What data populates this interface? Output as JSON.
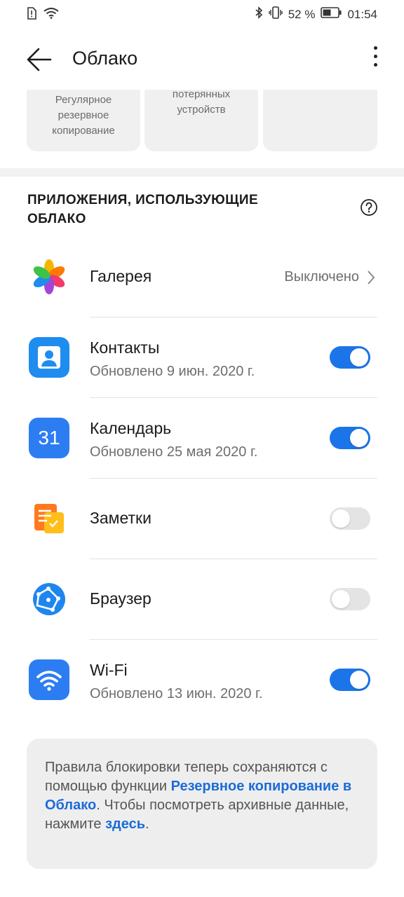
{
  "status_bar": {
    "battery_percent": "52 %",
    "time": "01:54"
  },
  "header": {
    "title": "Облако"
  },
  "feature_cards": [
    {
      "label": "Регулярное резервное копирование"
    },
    {
      "label": "потерянных устройств"
    },
    {
      "label": ""
    }
  ],
  "section": {
    "title": "ПРИЛОЖЕНИЯ, ИСПОЛЬЗУЮЩИЕ ОБЛАКО"
  },
  "apps": [
    {
      "name": "Галерея",
      "value": "Выключено",
      "icon": "gallery-icon"
    },
    {
      "name": "Контакты",
      "subtitle": "Обновлено 9 июн. 2020 г.",
      "toggle": "on",
      "icon": "contacts-icon"
    },
    {
      "name": "Календарь",
      "subtitle": "Обновлено 25 мая 2020 г.",
      "toggle": "on",
      "icon": "calendar-icon",
      "icon_text": "31"
    },
    {
      "name": "Заметки",
      "toggle": "off",
      "icon": "notes-icon"
    },
    {
      "name": "Браузер",
      "toggle": "off",
      "icon": "browser-icon"
    },
    {
      "name": "Wi-Fi",
      "subtitle": "Обновлено 13 июн. 2020 г.",
      "toggle": "on",
      "icon": "wifi-icon"
    }
  ],
  "notice": {
    "text_1": "Правила блокировки теперь сохраняются с помощью функции ",
    "link_1": "Резервное копирование в Облако",
    "text_2": ". Чтобы посмотреть архивные данные, нажмите ",
    "link_2": "здесь",
    "text_3": "."
  },
  "colors": {
    "accent": "#1c74e9",
    "link": "#1c6cd8",
    "toggle_off": "#e4e4e4"
  }
}
